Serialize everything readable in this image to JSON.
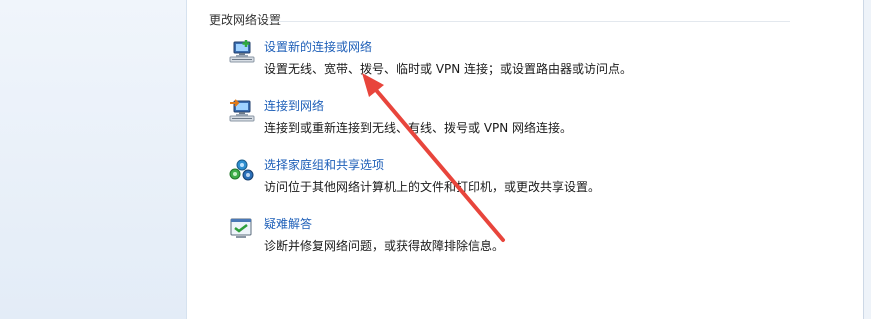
{
  "section": {
    "header": "更改网络设置"
  },
  "tasks": [
    {
      "title": "设置新的连接或网络",
      "desc": "设置无线、宽带、拨号、临时或 VPN 连接；或设置路由器或访问点。",
      "icon": "new-connection-icon"
    },
    {
      "title": "连接到网络",
      "desc": "连接到或重新连接到无线、有线、拨号或 VPN 网络连接。",
      "icon": "connect-network-icon"
    },
    {
      "title": "选择家庭组和共享选项",
      "desc": "访问位于其他网络计算机上的文件和打印机，或更改共享设置。",
      "icon": "homegroup-icon"
    },
    {
      "title": "疑难解答",
      "desc": "诊断并修复网络问题，或获得故障排除信息。",
      "icon": "troubleshoot-icon"
    }
  ],
  "colors": {
    "link": "#1e5fb8",
    "annotation_arrow": "#e8453c",
    "sidebar": "#e8eff8"
  }
}
